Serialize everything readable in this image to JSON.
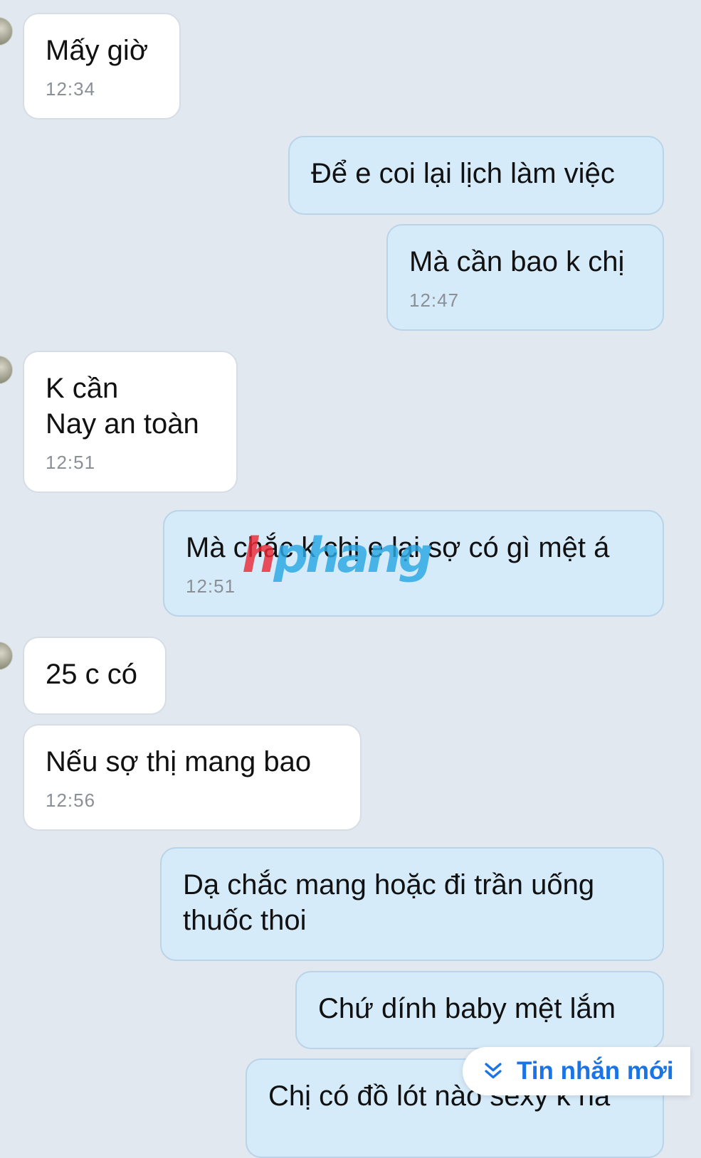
{
  "messages": [
    {
      "text": "Mấy giờ",
      "time": "12:34"
    },
    {
      "text": "Để e coi lại lịch làm việc",
      "time": ""
    },
    {
      "text": "Mà cần bao k chị",
      "time": "12:47"
    },
    {
      "text": "K cần\nNay an toàn",
      "time": "12:51"
    },
    {
      "text": "Mà chắc k chị e lại sợ có gì mệt á",
      "time": "12:51"
    },
    {
      "text": "25 c có",
      "time": ""
    },
    {
      "text": "Nếu sợ thị mang bao",
      "time": "12:56"
    },
    {
      "text": "Dạ chắc mang hoặc đi trần uống\nthuốc thoi",
      "time": ""
    },
    {
      "text": "Chứ dính baby mệt lắm",
      "time": ""
    },
    {
      "text": "Chị có đồ lót nào sexy k ha",
      "time": ""
    }
  ],
  "watermark": {
    "part1": "h",
    "part2": "phang"
  },
  "new_message_button": {
    "label": "Tin nhắn mới",
    "icon": "double-chevron-down-icon"
  },
  "colors": {
    "background": "#e2e8ef",
    "incoming_bubble": "#ffffff",
    "outgoing_bubble": "#d6ebfa",
    "accent": "#1a74e6"
  }
}
